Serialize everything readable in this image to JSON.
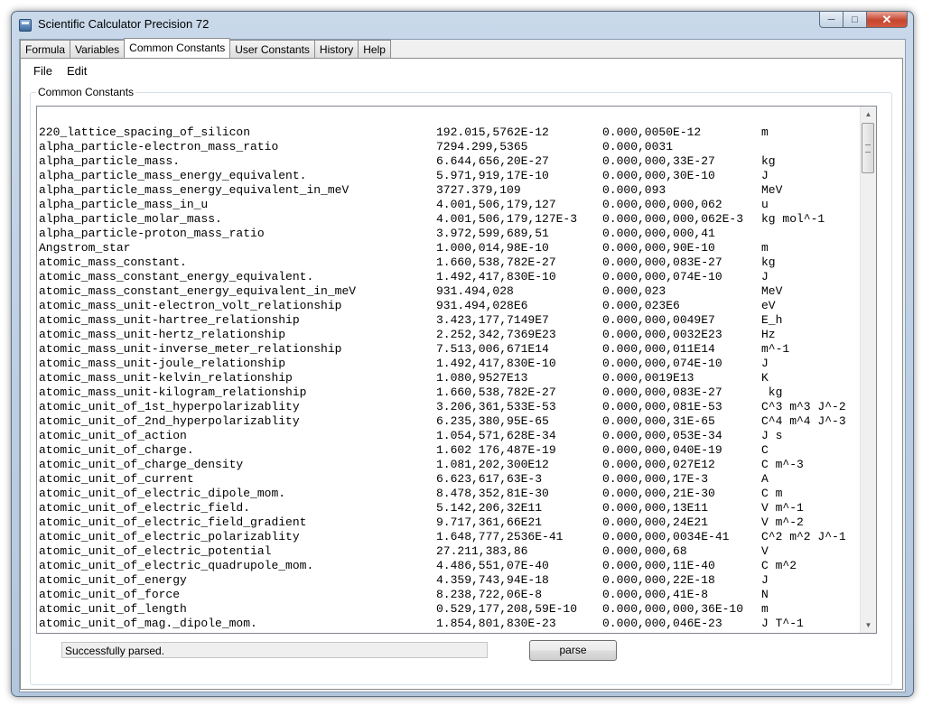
{
  "window": {
    "title": "Scientific Calculator Precision 72"
  },
  "controls": {
    "minimize": "─",
    "maximize": "□",
    "close": "✕"
  },
  "tabs": [
    "Formula",
    "Variables",
    "Common Constants",
    "User Constants",
    "History",
    "Help"
  ],
  "menu": [
    "File",
    "Edit"
  ],
  "group": {
    "label": "Common Constants"
  },
  "constants": [
    [
      "220_lattice_spacing_of_silicon",
      "192.015,5762E-12",
      "0.000,0050E-12",
      "m"
    ],
    [
      "alpha_particle-electron_mass_ratio",
      "7294.299,5365",
      "0.000,0031",
      ""
    ],
    [
      "alpha_particle_mass.",
      "6.644,656,20E-27",
      "0.000,000,33E-27",
      "kg"
    ],
    [
      "alpha_particle_mass_energy_equivalent.",
      "5.971,919,17E-10",
      "0.000,000,30E-10",
      "J"
    ],
    [
      "alpha_particle_mass_energy_equivalent_in_meV",
      "3727.379,109",
      "0.000,093",
      "MeV"
    ],
    [
      "alpha_particle_mass_in_u",
      "4.001,506,179,127",
      "0.000,000,000,062",
      "u"
    ],
    [
      "alpha_particle_molar_mass.",
      "4.001,506,179,127E-3",
      "0.000,000,000,062E-3",
      "kg mol^-1"
    ],
    [
      "alpha_particle-proton_mass_ratio",
      "3.972,599,689,51",
      "0.000,000,000,41",
      ""
    ],
    [
      "Angstrom_star",
      "1.000,014,98E-10",
      "0.000,000,90E-10",
      "m"
    ],
    [
      "atomic_mass_constant.",
      "1.660,538,782E-27",
      "0.000,000,083E-27",
      "kg"
    ],
    [
      "atomic_mass_constant_energy_equivalent.",
      "1.492,417,830E-10",
      "0.000,000,074E-10",
      "J"
    ],
    [
      "atomic_mass_constant_energy_equivalent_in_meV",
      "931.494,028",
      "0.000,023",
      "MeV"
    ],
    [
      "atomic_mass_unit-electron_volt_relationship",
      "931.494,028E6",
      "0.000,023E6",
      "eV"
    ],
    [
      "atomic_mass_unit-hartree_relationship",
      "3.423,177,7149E7",
      "0.000,000,0049E7",
      "E_h"
    ],
    [
      "atomic_mass_unit-hertz_relationship",
      "2.252,342,7369E23",
      "0.000,000,0032E23",
      "Hz"
    ],
    [
      "atomic_mass_unit-inverse_meter_relationship",
      "7.513,006,671E14",
      "0.000,000,011E14",
      "m^-1"
    ],
    [
      "atomic_mass_unit-joule_relationship",
      "1.492,417,830E-10",
      "0.000,000,074E-10",
      "J"
    ],
    [
      "atomic_mass_unit-kelvin_relationship",
      "1.080,9527E13",
      "0.000,0019E13",
      "K"
    ],
    [
      "atomic_mass_unit-kilogram_relationship",
      "1.660,538,782E-27",
      "0.000,000,083E-27",
      " kg"
    ],
    [
      "atomic_unit_of_1st_hyperpolarizablity",
      "3.206,361,533E-53",
      "0.000,000,081E-53",
      "C^3 m^3 J^-2"
    ],
    [
      "atomic_unit_of_2nd_hyperpolarizablity",
      "6.235,380,95E-65",
      "0.000,000,31E-65",
      "C^4 m^4 J^-3"
    ],
    [
      "atomic_unit_of_action",
      "1.054,571,628E-34",
      "0.000,000,053E-34",
      "J s"
    ],
    [
      "atomic_unit_of_charge.",
      "1.602 176,487E-19",
      "0.000,000,040E-19",
      "C"
    ],
    [
      "atomic_unit_of_charge_density",
      "1.081,202,300E12",
      "0.000,000,027E12",
      "C m^-3"
    ],
    [
      "atomic_unit_of_current",
      "6.623,617,63E-3",
      "0.000,000,17E-3",
      "A"
    ],
    [
      "atomic_unit_of_electric_dipole_mom.",
      "8.478,352,81E-30",
      "0.000,000,21E-30",
      "C m"
    ],
    [
      "atomic_unit_of_electric_field.",
      "5.142,206,32E11",
      "0.000,000,13E11",
      "V m^-1"
    ],
    [
      "atomic_unit_of_electric_field_gradient",
      "9.717,361,66E21",
      "0.000,000,24E21",
      "V m^-2"
    ],
    [
      "atomic_unit_of_electric_polarizablity",
      "1.648,777,2536E-41",
      "0.000,000,0034E-41",
      "C^2 m^2 J^-1"
    ],
    [
      "atomic_unit_of_electric_potential",
      "27.211,383,86",
      "0.000,000,68",
      "V"
    ],
    [
      "atomic_unit_of_electric_quadrupole_mom.",
      "4.486,551,07E-40",
      "0.000,000,11E-40",
      "C m^2"
    ],
    [
      "atomic_unit_of_energy",
      "4.359,743,94E-18",
      "0.000,000,22E-18",
      "J"
    ],
    [
      "atomic_unit_of_force",
      "8.238,722,06E-8",
      "0.000,000,41E-8",
      "N"
    ],
    [
      "atomic_unit_of_length",
      "0.529,177,208,59E-10",
      "0.000,000,000,36E-10",
      "m"
    ],
    [
      "atomic_unit_of_mag._dipole_mom.",
      "1.854,801,830E-23",
      "0.000,000,046E-23",
      "J T^-1"
    ]
  ],
  "status": {
    "text": "Successfully parsed."
  },
  "parse_button": {
    "label": "parse"
  },
  "icons": {
    "app": "calculator-icon",
    "scroll_up": "chevron-up-icon",
    "scroll_down": "chevron-down-icon"
  }
}
